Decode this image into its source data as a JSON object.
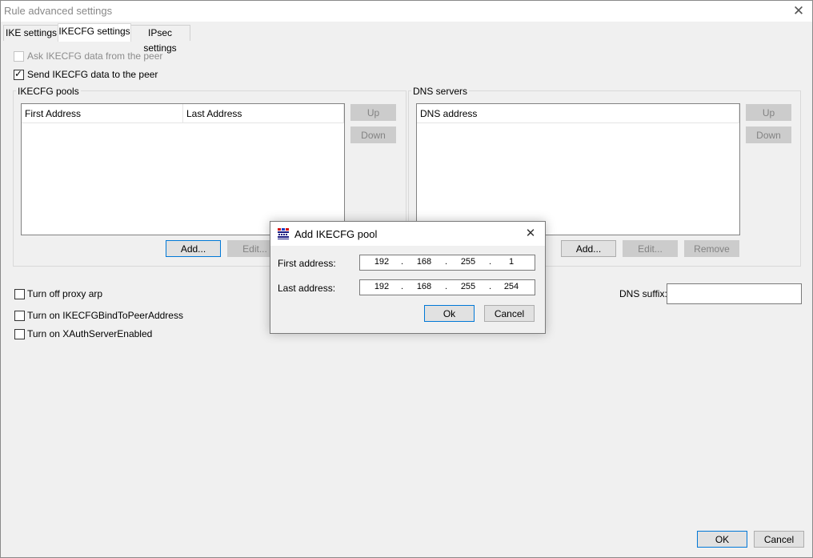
{
  "window": {
    "title": "Rule advanced settings",
    "close_glyph": "✕"
  },
  "tabs": [
    {
      "label": "IKE settings",
      "active": false
    },
    {
      "label": "IKECFG settings",
      "active": true
    },
    {
      "label": "IPsec settings",
      "active": false
    }
  ],
  "checks": {
    "ask_peer": {
      "label": "Ask IKECFG data from the peer",
      "checked": false,
      "enabled": false
    },
    "send_peer": {
      "label": "Send IKECFG data to the peer",
      "checked": true,
      "enabled": true
    },
    "proxy_arp": {
      "label": "Turn off proxy arp",
      "checked": false
    },
    "bind_peer": {
      "label": "Turn on IKECFGBindToPeerAddress",
      "checked": false
    },
    "xauth": {
      "label": "Turn on XAuthServerEnabled",
      "checked": false
    }
  },
  "check_mark": "✓",
  "pools": {
    "title": "IKECFG pools",
    "columns": [
      "First Address",
      "Last Address"
    ],
    "up": "Up",
    "down": "Down",
    "add": "Add...",
    "edit": "Edit..."
  },
  "dns": {
    "title": "DNS servers",
    "columns": [
      "DNS address"
    ],
    "up": "Up",
    "down": "Down",
    "add": "Add...",
    "edit": "Edit...",
    "remove": "Remove",
    "suffix_label": "DNS suffix:",
    "suffix_value": ""
  },
  "dialog": {
    "title": "Add IKECFG pool",
    "close_glyph": "✕",
    "first_label": "First address:",
    "first": [
      "192",
      "168",
      "255",
      "1"
    ],
    "last_label": "Last address:",
    "last": [
      "192",
      "168",
      "255",
      "254"
    ],
    "dot": ".",
    "ok": "Ok",
    "cancel": "Cancel"
  },
  "footer": {
    "ok": "OK",
    "cancel": "Cancel"
  },
  "colors": {
    "accent": "#0078d7",
    "disabled_text": "#838383"
  }
}
